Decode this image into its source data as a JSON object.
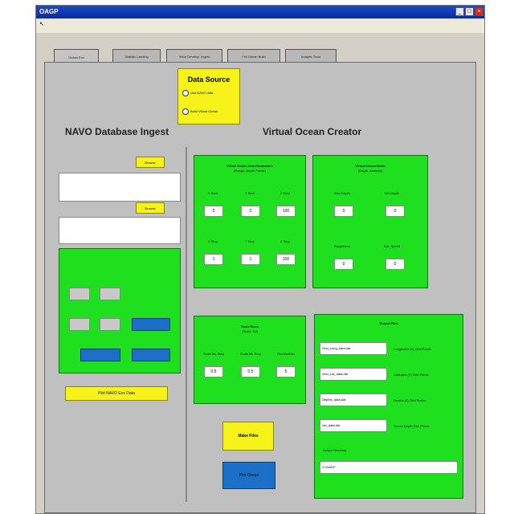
{
  "window": {
    "title": "OAGP"
  },
  "tabs": [
    "Ocean Env",
    "Statistic Landing",
    "Wind Develop. Ingest",
    "Full Ocean Build",
    "Analytic Tools"
  ],
  "data_source": {
    "title": "Data Source",
    "options": [
      "Use NAVO data",
      "Build Virtual Ocean"
    ]
  },
  "navo": {
    "title": "NAVO Database Ingest",
    "browse_label_1": "Browse",
    "browse_label_2": "Browse",
    "green_title": "",
    "gray_button": "",
    "blue_buttons": [
      "",
      ""
    ],
    "yellow_button": "Plot NAVO Env Data"
  },
  "voc": {
    "title": "Virtual Ocean Creator",
    "grid": {
      "title": "Virtual Ocean Grid Parameters",
      "subtitle": "(Range, Depth Points)",
      "fields": [
        {
          "label": "X Start",
          "value": "0"
        },
        {
          "label": "Y Start",
          "value": "0"
        },
        {
          "label": "Z Start",
          "value": "100"
        },
        {
          "label": "X Stop",
          "value": "1"
        },
        {
          "label": "Y Stop",
          "value": "1"
        },
        {
          "label": "Z Stop",
          "value": "100"
        }
      ]
    },
    "ocean": {
      "title": "Virtual Ocean Botto",
      "subtitle": "(Depth, Material)",
      "fields": [
        {
          "label": "Max Depth",
          "value": "0"
        },
        {
          "label": "Min Depth",
          "value": "0"
        },
        {
          "label": "Roughness",
          "value": "0"
        },
        {
          "label": "Mat. Speed",
          "value": "0"
        }
      ]
    },
    "scale": {
      "title": "Scale Sizes",
      "subtitle": "(Scale, Tol)",
      "fields": [
        {
          "label": "Scale ML Step",
          "value": "0.5"
        },
        {
          "label": "Scale ML Stop",
          "value": "0.5"
        },
        {
          "label": "Plot Number",
          "value": "5"
        }
      ]
    },
    "output": {
      "title": "Output Files",
      "files": [
        {
          "value": "Grid_Long_data.dat",
          "label": "Longitudes (X) Grid Points"
        },
        {
          "value": "Grid_Lat_data.dat",
          "label": "Latitudes (Y) Grid Points"
        },
        {
          "value": "Depths_data.dat",
          "label": "Depths (Z) Grid Points"
        },
        {
          "value": "Vel_data.dat",
          "label": "Ocean Depth Grid Points"
        }
      ],
      "dir_label": "Output Directory",
      "dir_value": "C:\\OAGP"
    },
    "buttons": {
      "make": "Make Files",
      "plot": "Plot Ocean"
    }
  },
  "colors": {
    "green": "#1ee01e",
    "yellow": "#f7f21a",
    "blue": "#1b6fc7",
    "panel": "#c0c0c0"
  }
}
